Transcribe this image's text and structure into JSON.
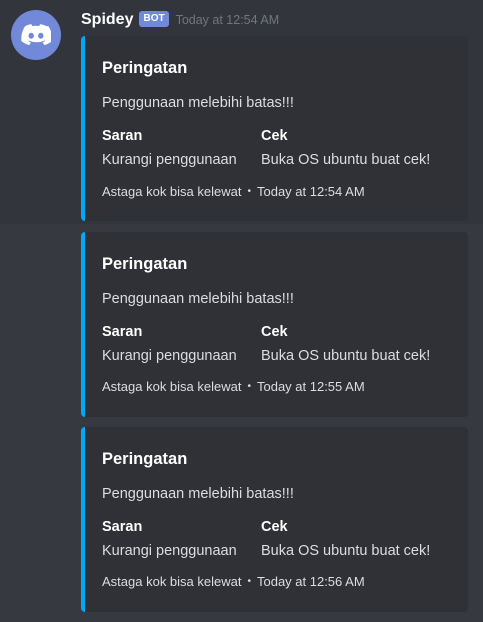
{
  "message": {
    "username": "Spidey",
    "bot_tag": "BOT",
    "timestamp": "Today at 12:54 AM",
    "avatar_icon": "discord-logo-icon",
    "colors": {
      "background": "#36393f",
      "embed_bg": "#2f3136",
      "embed_accent": "#03a9f4",
      "bot_tag": "#7289da",
      "avatar": "#7289da"
    }
  },
  "embeds": [
    {
      "title": "Peringatan",
      "description": "Penggunaan melebihi batas!!!",
      "fields": [
        {
          "name": "Saran",
          "value": "Kurangi penggunaan"
        },
        {
          "name": "Cek",
          "value": "Buka OS ubuntu buat cek!"
        }
      ],
      "footer_text": "Astaga kok bisa kelewat",
      "footer_separator": "•",
      "footer_time": "Today at 12:54 AM"
    },
    {
      "title": "Peringatan",
      "description": "Penggunaan melebihi batas!!!",
      "fields": [
        {
          "name": "Saran",
          "value": "Kurangi penggunaan"
        },
        {
          "name": "Cek",
          "value": "Buka OS ubuntu buat cek!"
        }
      ],
      "footer_text": "Astaga kok bisa kelewat",
      "footer_separator": "•",
      "footer_time": "Today at 12:55 AM"
    },
    {
      "title": "Peringatan",
      "description": "Penggunaan melebihi batas!!!",
      "fields": [
        {
          "name": "Saran",
          "value": "Kurangi penggunaan"
        },
        {
          "name": "Cek",
          "value": "Buka OS ubuntu buat cek!"
        }
      ],
      "footer_text": "Astaga kok bisa kelewat",
      "footer_separator": "•",
      "footer_time": "Today at 12:56 AM"
    }
  ]
}
